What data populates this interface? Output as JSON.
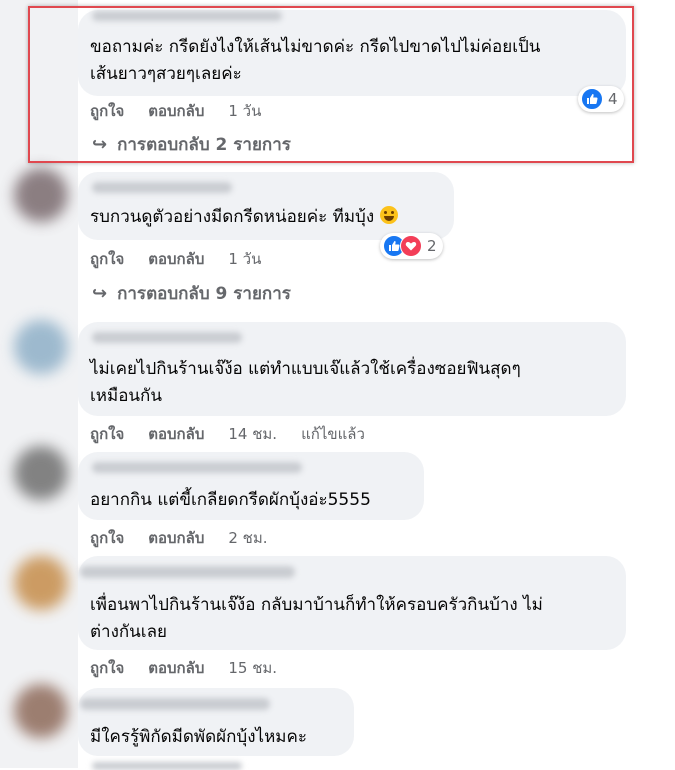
{
  "labels": {
    "like": "ถูกใจ",
    "reply": "ตอบกลับ"
  },
  "comments": [
    {
      "line1": "ขอถามค่ะ กรีดยังไงให้เส้นไม่ขาดค่ะ กรีดไปขาดไปไม่ค่อยเป็น",
      "line2": "เส้นยาวๆสวยๆเลยค่ะ",
      "time": "1 วัน",
      "reactions": "4",
      "replies": "การตอบกลับ 2 รายการ"
    },
    {
      "line1": "รบกวนดูตัวอย่างมีดกรีดหน่อยค่ะ ทีมบุ้ง",
      "time": "1 วัน",
      "reactions": "2",
      "replies": "การตอบกลับ 9 รายการ"
    },
    {
      "line1": "ไม่เคยไปกินร้านเจ๊ง้อ แต่ทำแบบเจ๊แล้วใช้เครื่องซอยฟินสุดๆ",
      "line2": "เหมือนกัน",
      "time": "14 ชม.",
      "edited": "แก้ไขแล้ว"
    },
    {
      "line1": "อยากกิน แต่ขี้เกลียดกรีดผักบุ้งอ่ะ5555",
      "time": "2 ชม."
    },
    {
      "line1": "เพื่อนพาไปกินร้านเจ๊ง้อ กลับมาบ้านก็ทำให้ครอบครัวกินบ้าง ไม่",
      "line2": "ต่างกันเลย",
      "time": "15 ชม."
    },
    {
      "line1": "มีใครรู้พิกัดมีดพัดผักบุ้งไหมคะ"
    }
  ],
  "colors": {
    "accent": "#1877f2",
    "love": "#f33e58",
    "highlight": "#e0484f",
    "bubble": "#f0f2f5",
    "secondary_text": "#65676b"
  }
}
